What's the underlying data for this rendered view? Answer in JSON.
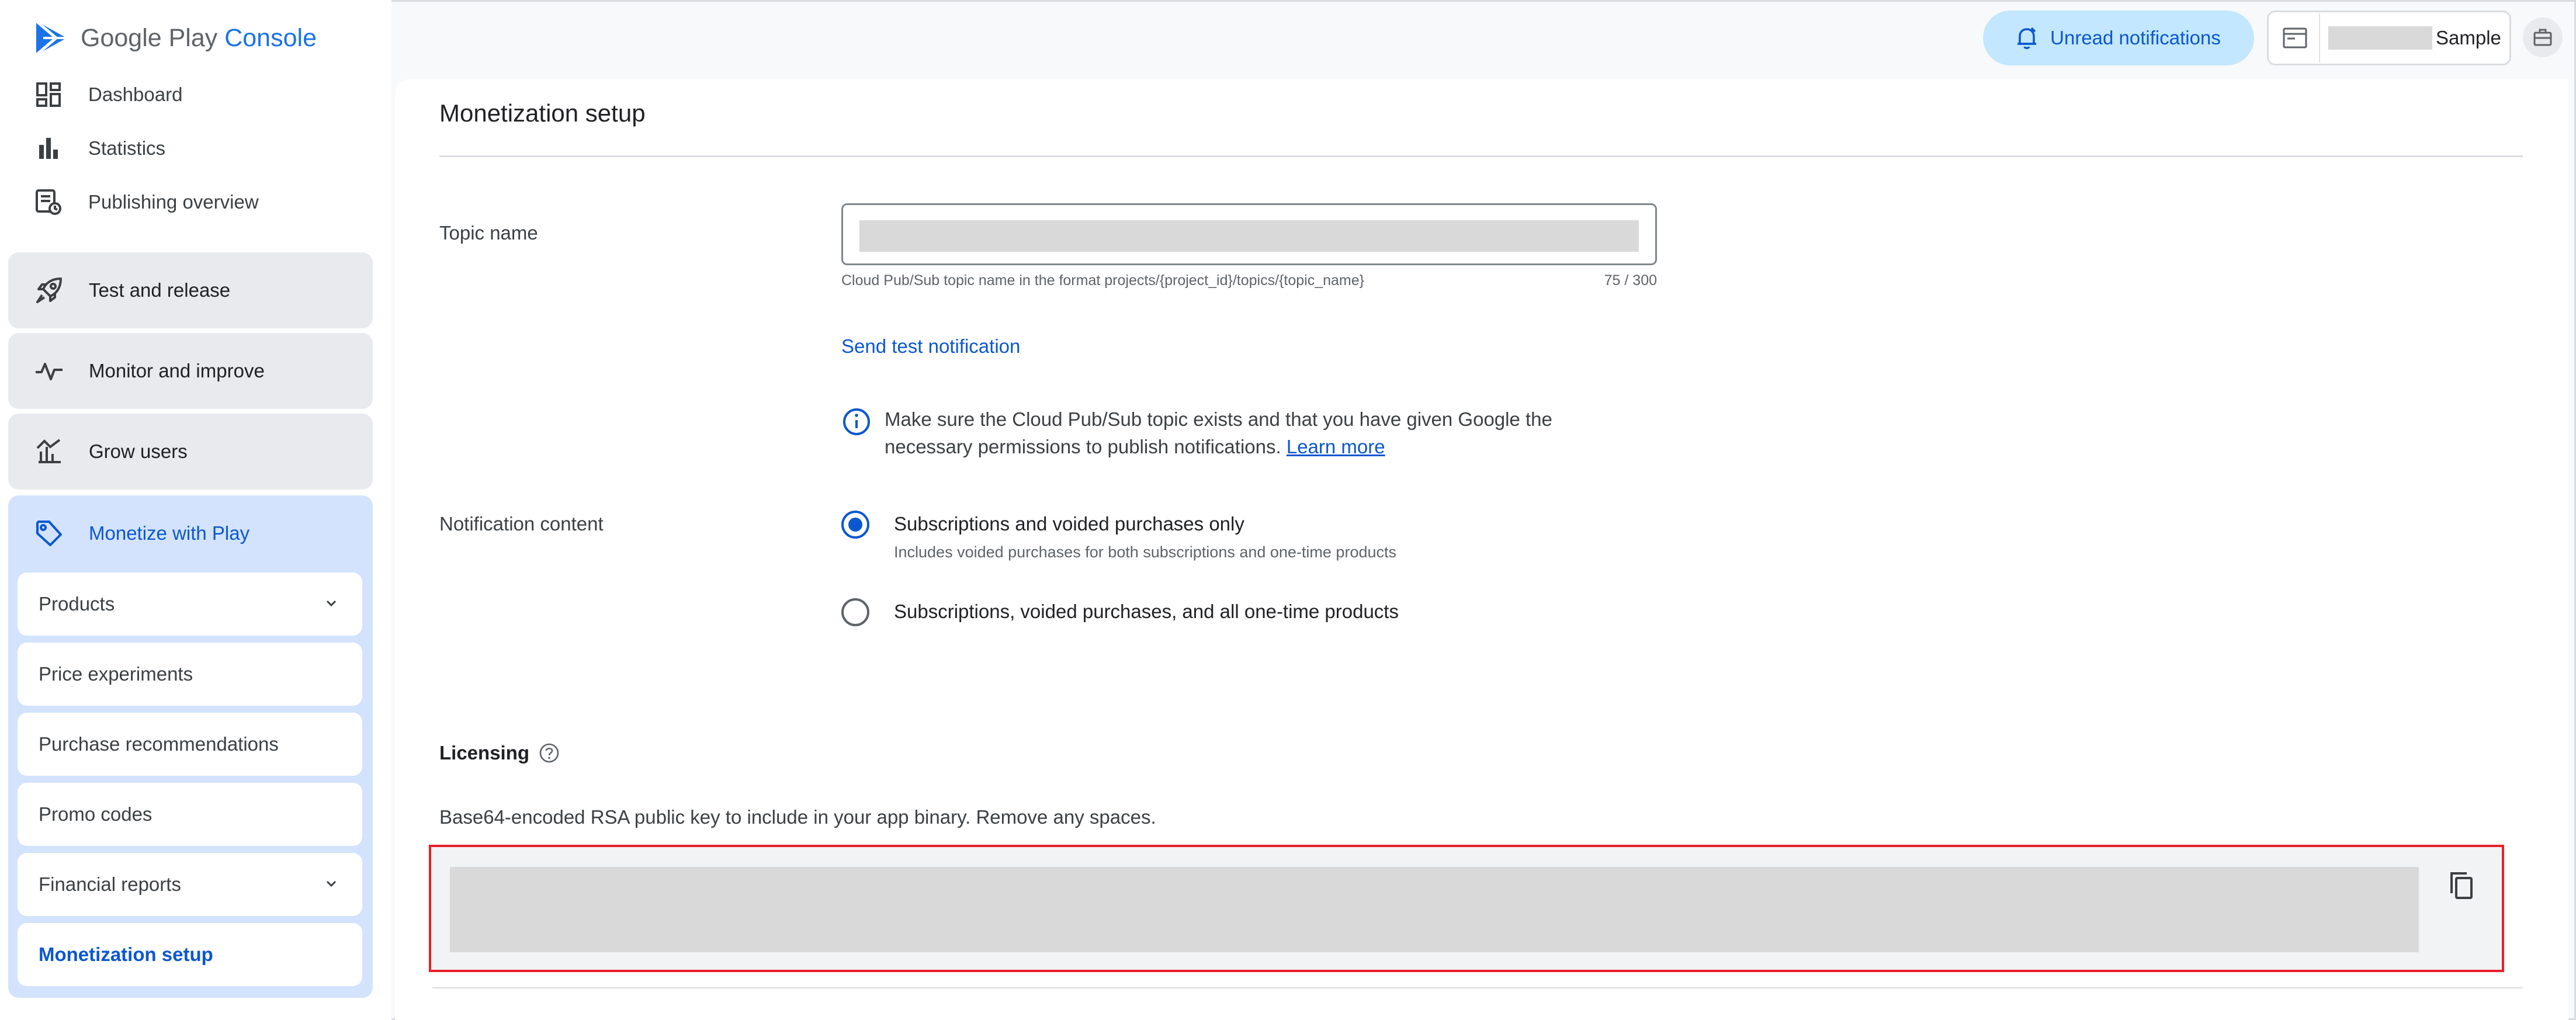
{
  "app": {
    "logo_google_play": "Google Play",
    "logo_console": "Console"
  },
  "nav": {
    "dashboard": "Dashboard",
    "statistics": "Statistics",
    "publishing_overview": "Publishing overview",
    "test_and_release": "Test and release",
    "monitor_and_improve": "Monitor and improve",
    "grow_users": "Grow users",
    "monetize_with_play": "Monetize with Play",
    "sub_items": [
      "Products",
      "Price experiments",
      "Purchase recommendations",
      "Promo codes",
      "Financial reports",
      "Monetization setup"
    ],
    "current_item": "Monetization setup"
  },
  "header": {
    "notifications_label": "Unread notifications",
    "account_name": "Sample"
  },
  "page": {
    "title": "Monetization setup",
    "topic_name_label": "Topic name",
    "topic_helper": "Cloud Pub/Sub topic name in the format projects/{project_id}/topics/{topic_name}",
    "topic_counter": "75 / 300",
    "send_test_notification": "Send test notification",
    "info_text": "Make sure the Cloud Pub/Sub topic exists and that you have given Google the necessary permissions to publish notifications.",
    "info_link": "Learn more",
    "notification_content_label": "Notification content",
    "radio_option_1": "Subscriptions and voided purchases only",
    "radio_option_1_sub": "Includes voided purchases for both subscriptions and one-time products",
    "radio_option_2": "Subscriptions, voided purchases, and all one-time products",
    "selected_option": "Subscriptions and voided purchases only",
    "licensing_heading": "Licensing",
    "licensing_desc": "Base64-encoded RSA public key to include in your app binary. Remove any spaces."
  },
  "colors": {
    "accent": "#0b57d0",
    "active_nav_bg": "#d3e3fd",
    "highlight_border": "#e8202a"
  }
}
